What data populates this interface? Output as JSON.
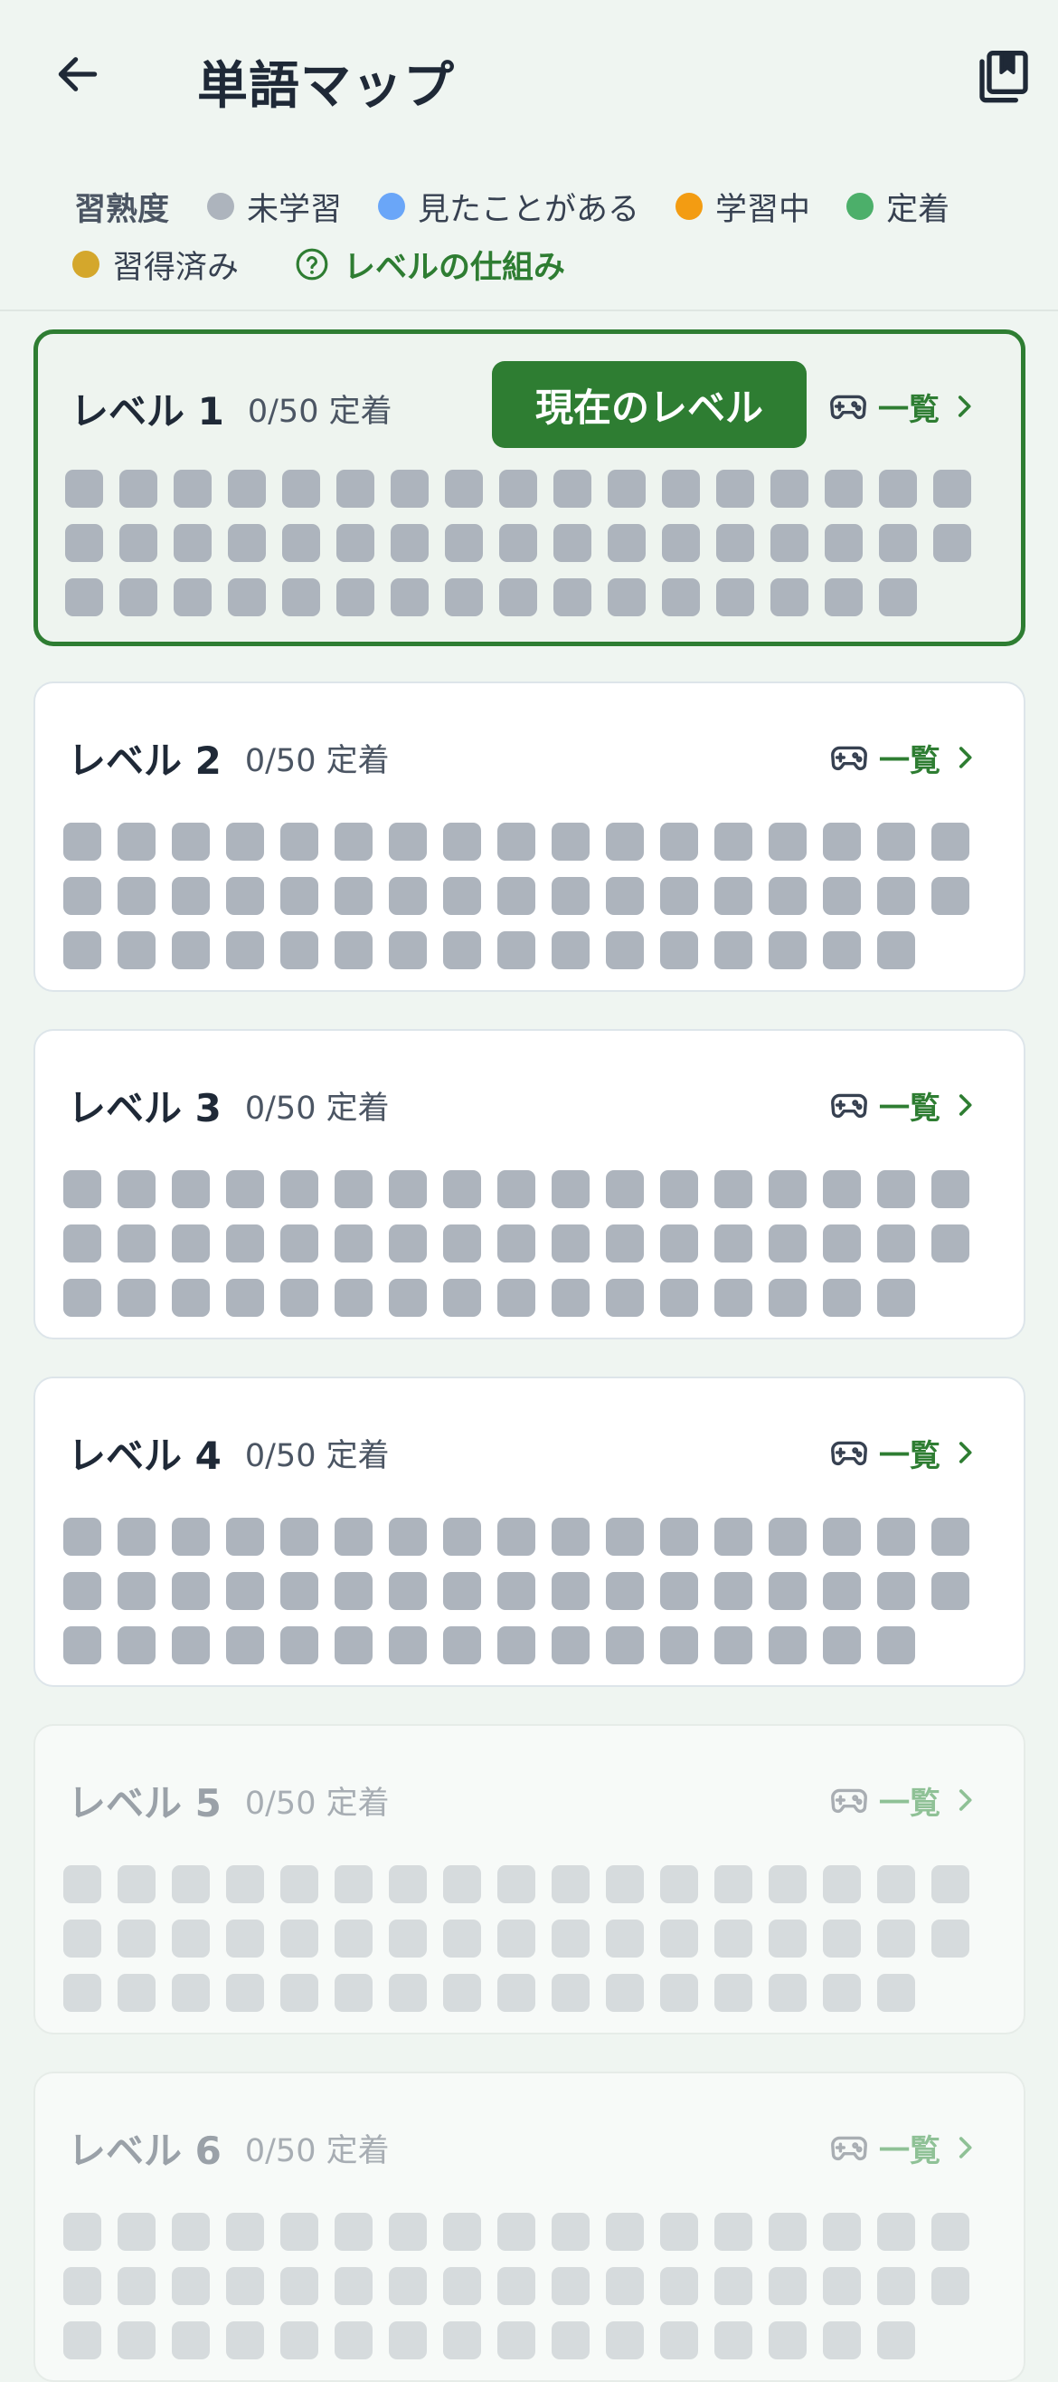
{
  "header": {
    "title": "単語マップ",
    "back_icon": "arrow-left-icon",
    "bookmark_icon": "bookmarks-icon"
  },
  "legend": {
    "title": "習熟度",
    "items": [
      {
        "label": "未学習",
        "color": "#adb4bd"
      },
      {
        "label": "見たことがある",
        "color": "#6aa6f8"
      },
      {
        "label": "学習中",
        "color": "#f39c12"
      },
      {
        "label": "定着",
        "color": "#4caf6a"
      },
      {
        "label": "習得済み",
        "color": "#d4a72c"
      }
    ],
    "help_label": "レベルの仕組み"
  },
  "colors": {
    "accent": "#2e7d32",
    "unlearned_cell": "#adb4bd",
    "locked_cell": "#d6dbdd"
  },
  "current_badge": "現在のレベル",
  "list_label": "一覧",
  "levels": [
    {
      "name": "レベル 1",
      "progress": "0/50 定着",
      "current": true,
      "locked": false,
      "words": 50
    },
    {
      "name": "レベル 2",
      "progress": "0/50 定着",
      "current": false,
      "locked": false,
      "words": 50
    },
    {
      "name": "レベル 3",
      "progress": "0/50 定着",
      "current": false,
      "locked": false,
      "words": 50
    },
    {
      "name": "レベル 4",
      "progress": "0/50 定着",
      "current": false,
      "locked": false,
      "words": 50
    },
    {
      "name": "レベル 5",
      "progress": "0/50 定着",
      "current": false,
      "locked": true,
      "words": 50
    },
    {
      "name": "レベル 6",
      "progress": "0/50 定着",
      "current": false,
      "locked": true,
      "words": 50
    }
  ]
}
